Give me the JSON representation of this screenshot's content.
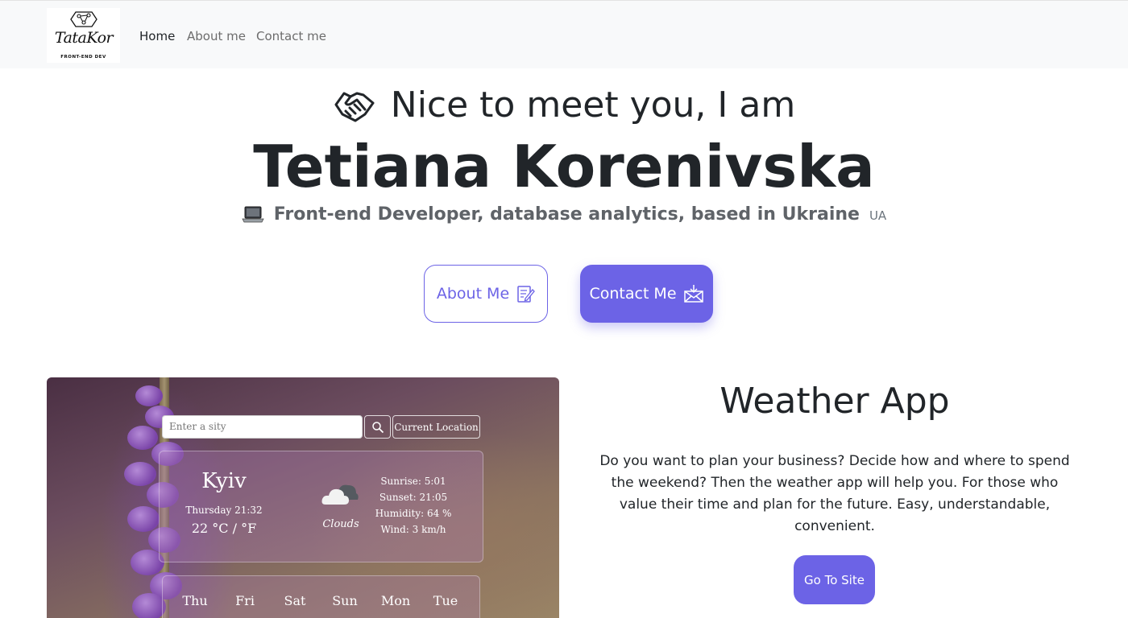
{
  "nav": {
    "logo": {
      "script": "TataKor",
      "sub": "FRONT-END DEV"
    },
    "links": [
      {
        "label": "Home",
        "active": true
      },
      {
        "label": "About me",
        "active": false
      },
      {
        "label": "Contact me",
        "active": false
      }
    ]
  },
  "hero": {
    "greeting": "Nice to meet you, I am",
    "name": "Tetiana Korenivska",
    "role": "Front-end Developer, database analytics, based in Ukraine",
    "flag": "UA",
    "about_button": "About Me",
    "contact_button": "Contact Me"
  },
  "preview": {
    "search_placeholder": "Enter a sity",
    "location_button": "Current Location",
    "city": "Kyiv",
    "date": "Thursday 21:32",
    "temperature": "22 °C / °F",
    "description": "Clouds",
    "details": [
      "Sunrise: 5:01",
      "Sunset: 21:05",
      "Humidity: 64 %",
      "Wind: 3 km/h"
    ],
    "forecast_days": [
      "Thu",
      "Fri",
      "Sat",
      "Sun",
      "Mon",
      "Tue"
    ]
  },
  "project": {
    "title": "Weather App",
    "description": "Do you want to plan your business? Decide how and where to spend the weekend? Then the weather app will help you. For those who value their time and plan for the future. Easy, understandable, convenient.",
    "site_button": "Go To Site"
  },
  "colors": {
    "accent": "#6c63e6",
    "navbar_bg": "#f8f9fa",
    "text": "#212529",
    "muted": "#6c6c6c"
  }
}
